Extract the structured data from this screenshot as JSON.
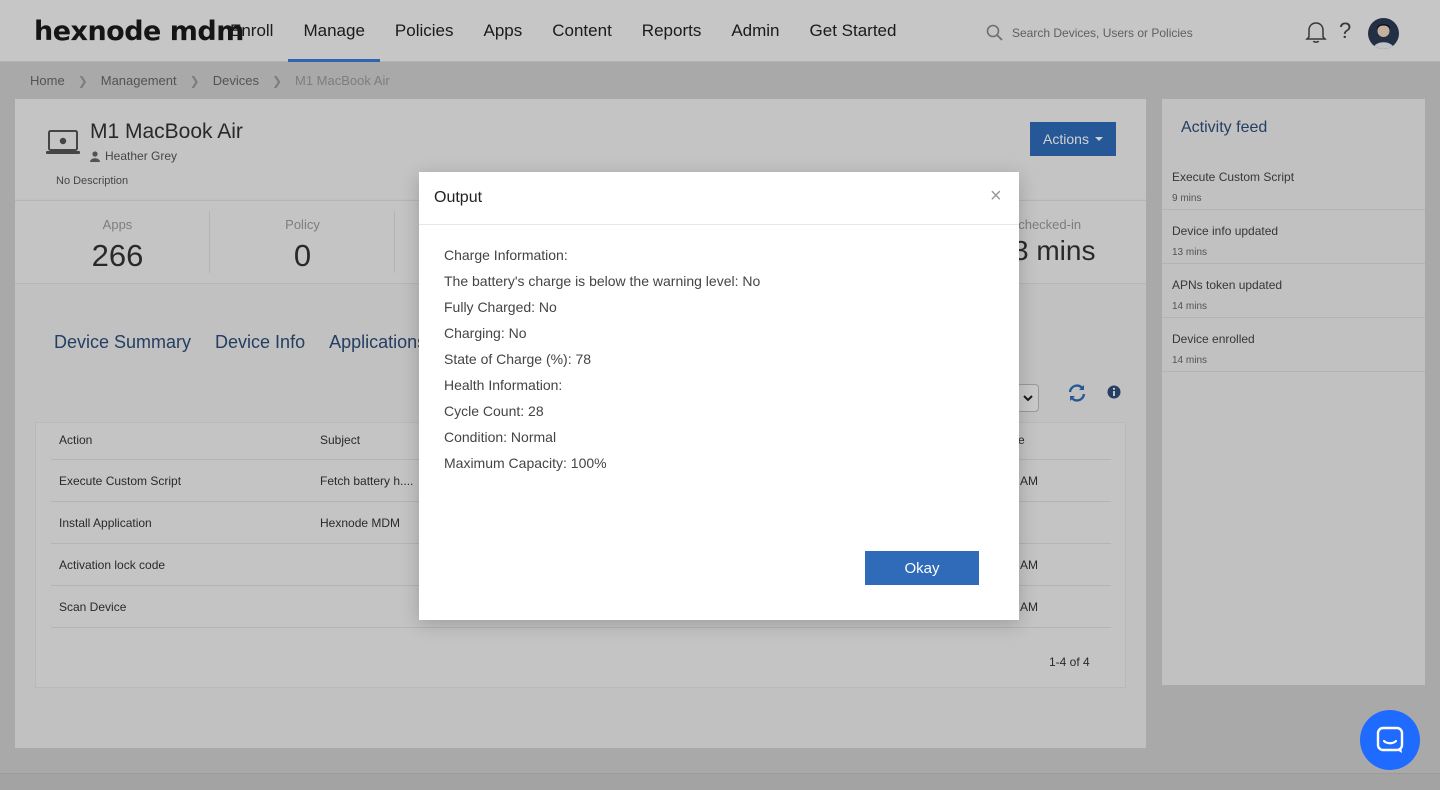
{
  "brand": {
    "logo": "hexnode mdm"
  },
  "nav": {
    "items": [
      "Enroll",
      "Manage",
      "Policies",
      "Apps",
      "Content",
      "Reports",
      "Admin",
      "Get Started"
    ],
    "active": "Manage"
  },
  "search": {
    "placeholder": "Search Devices, Users or Policies"
  },
  "help": {
    "label": "?"
  },
  "breadcrumb": [
    "Home",
    "Management",
    "Devices",
    "M1 MacBook Air"
  ],
  "device": {
    "name": "M1 MacBook Air",
    "user": "Heather Grey",
    "description": "No Description",
    "actions_label": "Actions"
  },
  "stats": [
    {
      "label": "Apps",
      "value": "266"
    },
    {
      "label": "Policy",
      "value": "0"
    }
  ],
  "stat_right": {
    "label": "t checked-in",
    "value": "3 mins"
  },
  "tabs": [
    "Device Summary",
    "Device Info",
    "Applications"
  ],
  "table": {
    "headers": [
      "Action",
      "Subject",
      "e"
    ],
    "rows": [
      {
        "action": "Execute Custom Script",
        "subject": "Fetch battery h....",
        "tail": "AM"
      },
      {
        "action": "Install Application",
        "subject": "Hexnode MDM",
        "tail": ""
      },
      {
        "action": "Activation lock code",
        "subject": "",
        "tail": "AM"
      },
      {
        "action": "Scan Device",
        "subject": "",
        "tail": "AM"
      }
    ],
    "pager": "1-4 of 4"
  },
  "feed": {
    "title": "Activity feed",
    "items": [
      {
        "title": "Execute Custom Script",
        "time": "9 mins"
      },
      {
        "title": "Device info updated",
        "time": "13 mins"
      },
      {
        "title": "APNs token updated",
        "time": "14 mins"
      },
      {
        "title": "Device enrolled",
        "time": "14 mins"
      }
    ]
  },
  "modal": {
    "title": "Output",
    "close": "×",
    "lines": [
      "Charge Information:",
      "The battery's charge is below the warning level: No",
      "Fully Charged: No",
      "Charging: No",
      "State of Charge (%): 78",
      "Health Information:",
      "Cycle Count: 28",
      "Condition: Normal",
      "Maximum Capacity: 100%"
    ],
    "okay_label": "Okay"
  },
  "colors": {
    "accent": "#2f6bb8",
    "nav_active": "#3b7bd4",
    "tab_text": "#2d4d78",
    "chat": "#1f6bff"
  }
}
